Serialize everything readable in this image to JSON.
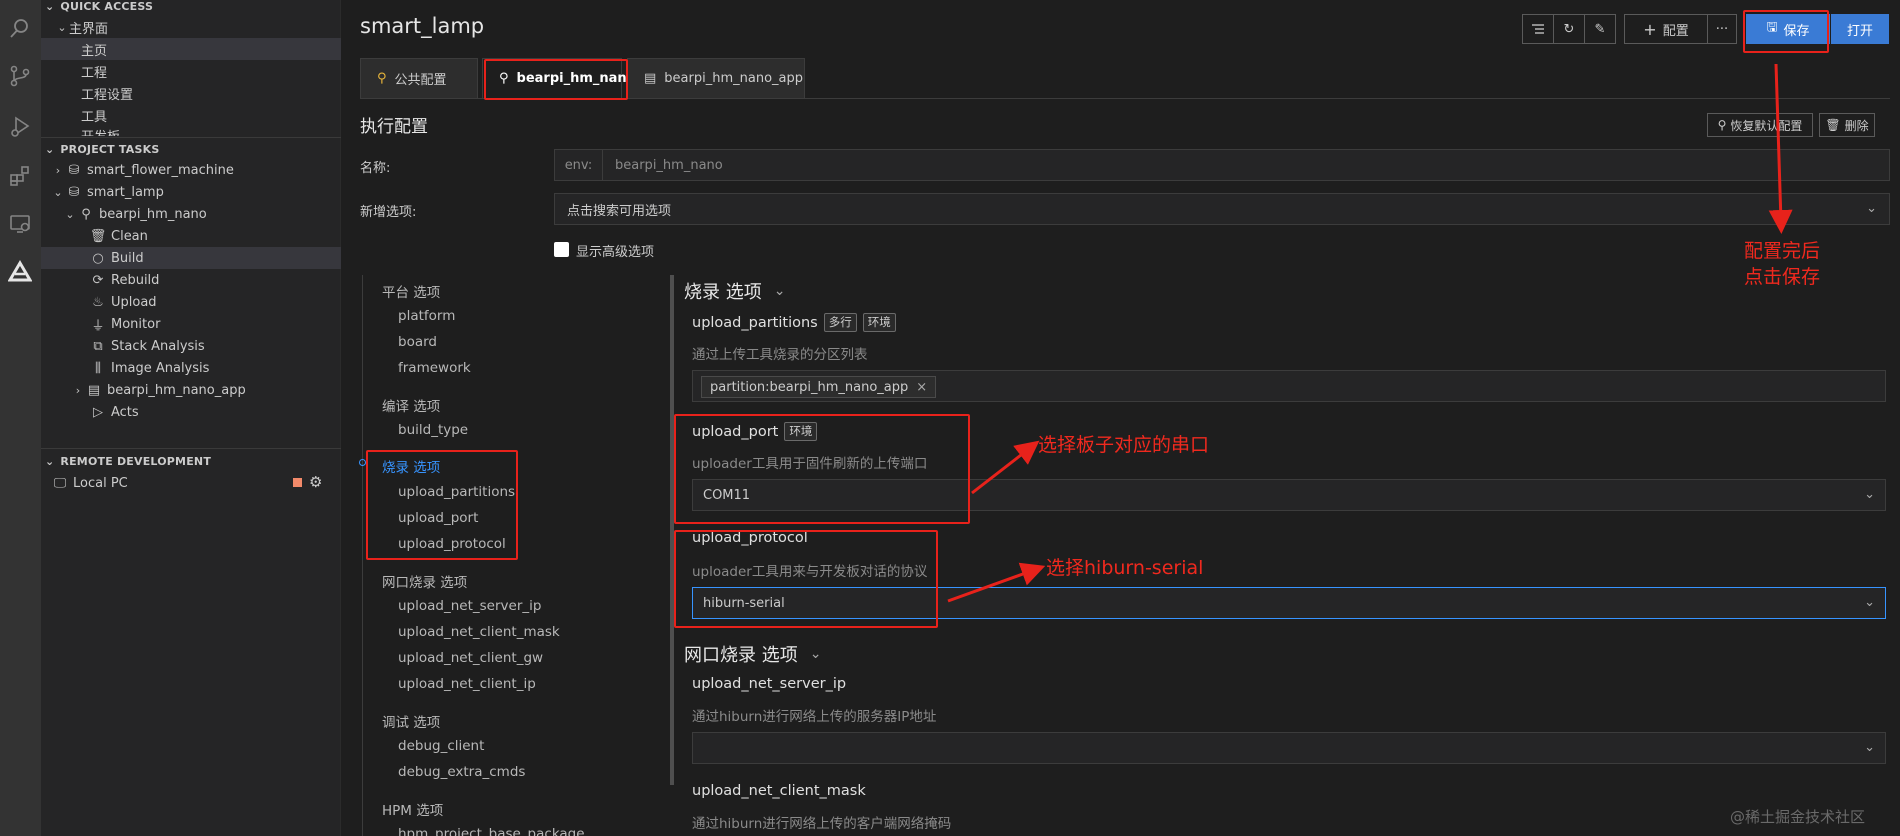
{
  "sidebar": {
    "quick_access": {
      "title": "QUICK ACCESS",
      "root": "主界面",
      "items": [
        "主页",
        "工程",
        "工程设置",
        "工具",
        "开发板"
      ]
    },
    "project_tasks": {
      "title": "PROJECT TASKS",
      "items": [
        {
          "label": "smart_flower_machine"
        },
        {
          "label": "smart_lamp"
        },
        {
          "label": "bearpi_hm_nano"
        },
        {
          "label": "Clean"
        },
        {
          "label": "Build"
        },
        {
          "label": "Rebuild"
        },
        {
          "label": "Upload"
        },
        {
          "label": "Monitor"
        },
        {
          "label": "Stack Analysis"
        },
        {
          "label": "Image Analysis"
        },
        {
          "label": "bearpi_hm_nano_app"
        },
        {
          "label": "Acts"
        }
      ]
    },
    "remote": {
      "title": "REMOTE DEVELOPMENT",
      "item": "Local PC"
    }
  },
  "main": {
    "title": "smart_lamp",
    "toolbar": {
      "add_label": "配置",
      "more_label": "···",
      "save_label": "保存",
      "open_label": "打开"
    },
    "tabs": [
      {
        "label": "公共配置"
      },
      {
        "label": "bearpi_hm_nano"
      },
      {
        "label": "bearpi_hm_nano_app"
      }
    ],
    "section_title": "执行配置",
    "restore_label": "恢复默认配置",
    "delete_label": "删除",
    "name_label": "名称:",
    "env_prefix": "env:",
    "env_value": "bearpi_hm_nano",
    "add_option_label": "新增选项:",
    "add_option_placeholder": "点击搜索可用选项",
    "show_advanced": "显示高级选项",
    "nav": [
      {
        "head": "平台 选项",
        "items": [
          "platform",
          "board",
          "framework"
        ]
      },
      {
        "head": "编译 选项",
        "items": [
          "build_type"
        ]
      },
      {
        "head": "烧录 选项",
        "items": [
          "upload_partitions",
          "upload_port",
          "upload_protocol"
        ]
      },
      {
        "head": "网口烧录 选项",
        "items": [
          "upload_net_server_ip",
          "upload_net_client_mask",
          "upload_net_client_gw",
          "upload_net_client_ip"
        ]
      },
      {
        "head": "调试 选项",
        "items": [
          "debug_client",
          "debug_extra_cmds"
        ]
      },
      {
        "head": "HPM 选项",
        "items": [
          "hpm_project_base_package"
        ]
      }
    ],
    "burn_group_title": "烧录 选项",
    "net_group_title": "网口烧录 选项",
    "options": {
      "upload_partitions": {
        "name": "upload_partitions",
        "badges": [
          "多行",
          "环境"
        ],
        "desc": "通过上传工具烧录的分区列表",
        "chip": "partition:bearpi_hm_nano_app",
        "chip_close": "×"
      },
      "upload_port": {
        "name": "upload_port",
        "badges": [
          "环境"
        ],
        "desc": "uploader工具用于固件刷新的上传端口",
        "value": "COM11"
      },
      "upload_protocol": {
        "name": "upload_protocol",
        "desc": "uploader工具用来与开发板对话的协议",
        "value": "hiburn-serial"
      },
      "upload_net_server_ip": {
        "name": "upload_net_server_ip",
        "desc": "通过hiburn进行网络上传的服务器IP地址",
        "value": ""
      },
      "upload_net_client_mask": {
        "name": "upload_net_client_mask",
        "desc": "通过hiburn进行网络上传的客户端网络掩码"
      }
    }
  },
  "annotations": {
    "save_note_line1": "配置完后",
    "save_note_line2": "点击保存",
    "port_note": "选择板子对应的串口",
    "protocol_note": "选择hiburn-serial"
  },
  "watermark": "@稀土掘金技术社区",
  "colors": {
    "accent_blue": "#3a7bd5",
    "annotation_red": "#e8221b",
    "panel_bg": "#252526",
    "editor_bg": "#1e1e1e"
  }
}
